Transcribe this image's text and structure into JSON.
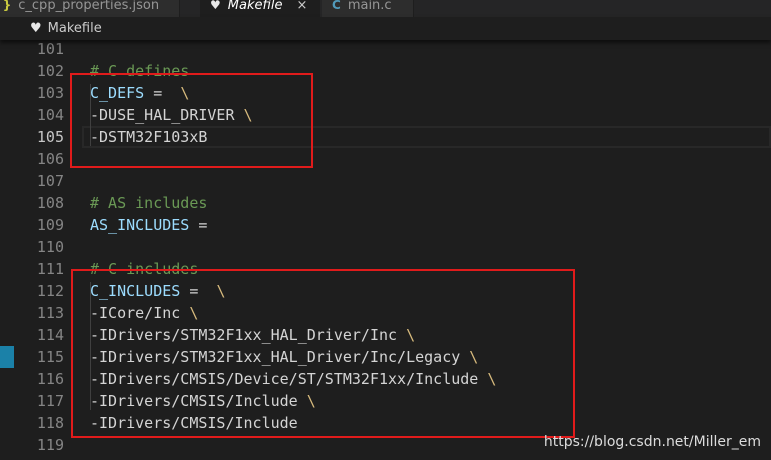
{
  "tabs": [
    {
      "icon": "{ }",
      "label": "c_cpp_properties.json",
      "active": false
    },
    {
      "icon": "♥",
      "label": "Makefile",
      "active": true,
      "close": "×"
    },
    {
      "icon": "C",
      "label": "main.c",
      "active": false
    }
  ],
  "breadcrumb": {
    "icon": "heart-icon",
    "label": "Makefile"
  },
  "lines": [
    {
      "n": "101",
      "tokens": []
    },
    {
      "n": "102",
      "tokens": [
        {
          "t": "# C defines",
          "c": "comment"
        }
      ]
    },
    {
      "n": "103",
      "tokens": [
        {
          "t": "C_DEFS",
          "c": "var"
        },
        {
          "t": " =  ",
          "c": "plain"
        },
        {
          "t": "\\",
          "c": "bs"
        }
      ]
    },
    {
      "n": "104",
      "tokens": [
        {
          "t": "-DUSE_HAL_DRIVER ",
          "c": "plain"
        },
        {
          "t": "\\",
          "c": "bs"
        }
      ]
    },
    {
      "n": "105",
      "tokens": [
        {
          "t": "-DSTM32F103xB",
          "c": "plain"
        }
      ],
      "current": true
    },
    {
      "n": "106",
      "tokens": []
    },
    {
      "n": "107",
      "tokens": []
    },
    {
      "n": "108",
      "tokens": [
        {
          "t": "# AS includes",
          "c": "comment"
        }
      ]
    },
    {
      "n": "109",
      "tokens": [
        {
          "t": "AS_INCLUDES",
          "c": "var"
        },
        {
          "t": " =",
          "c": "plain"
        }
      ]
    },
    {
      "n": "110",
      "tokens": []
    },
    {
      "n": "111",
      "tokens": [
        {
          "t": "# C includes",
          "c": "comment"
        }
      ]
    },
    {
      "n": "112",
      "tokens": [
        {
          "t": "C_INCLUDES",
          "c": "var"
        },
        {
          "t": " =  ",
          "c": "plain"
        },
        {
          "t": "\\",
          "c": "bs"
        }
      ]
    },
    {
      "n": "113",
      "tokens": [
        {
          "t": "-ICore/Inc ",
          "c": "plain"
        },
        {
          "t": "\\",
          "c": "bs"
        }
      ]
    },
    {
      "n": "114",
      "tokens": [
        {
          "t": "-IDrivers/STM32F1xx_HAL_Driver/Inc ",
          "c": "plain"
        },
        {
          "t": "\\",
          "c": "bs"
        }
      ]
    },
    {
      "n": "115",
      "tokens": [
        {
          "t": "-IDrivers/STM32F1xx_HAL_Driver/Inc/Legacy ",
          "c": "plain"
        },
        {
          "t": "\\",
          "c": "bs"
        }
      ],
      "gutter_mark": true
    },
    {
      "n": "116",
      "tokens": [
        {
          "t": "-IDrivers/CMSIS/Device/ST/STM32F1xx/Include ",
          "c": "plain"
        },
        {
          "t": "\\",
          "c": "bs"
        }
      ]
    },
    {
      "n": "117",
      "tokens": [
        {
          "t": "-IDrivers/CMSIS/Include ",
          "c": "plain"
        },
        {
          "t": "\\",
          "c": "bs"
        }
      ]
    },
    {
      "n": "118",
      "tokens": [
        {
          "t": "-IDrivers/CMSIS/Include",
          "c": "plain"
        }
      ]
    },
    {
      "n": "119",
      "tokens": []
    }
  ],
  "annotations": [
    {
      "name": "c-defs-highlight-box",
      "from_line": "103",
      "to_line": "106"
    },
    {
      "name": "c-includes-highlight-box",
      "from_line": "112",
      "to_line": "118"
    }
  ],
  "watermark": "https://blog.csdn.net/Miller_em",
  "colors": {
    "editor_bg": "#1e1e1e",
    "comment": "#6a9955",
    "variable": "#9cdcfe",
    "backslash": "#d7ba7d",
    "annotation_red": "#e01b1b",
    "gutter_mark": "#1b81a8"
  }
}
